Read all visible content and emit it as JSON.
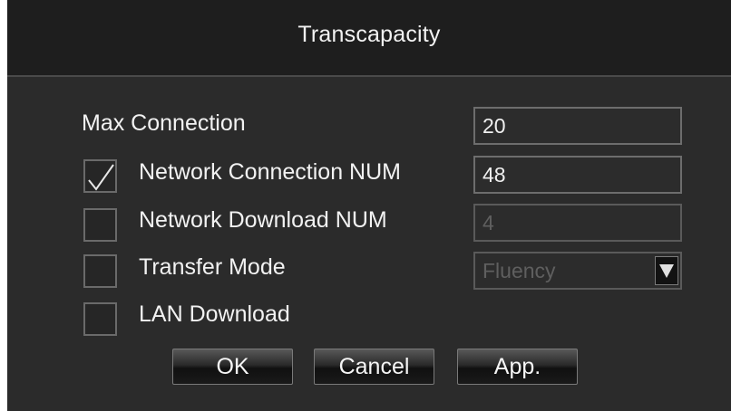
{
  "dialog": {
    "title": "Transcapacity"
  },
  "max_connection": {
    "label": "Max Connection",
    "value": "20"
  },
  "network_connection_num": {
    "label": "Network Connection NUM",
    "value": "48",
    "checked": true
  },
  "network_download_num": {
    "label": "Network Download NUM",
    "value": "4",
    "checked": false,
    "disabled": true
  },
  "transfer_mode": {
    "label": "Transfer Mode",
    "value": "Fluency",
    "checked": false,
    "disabled": true
  },
  "lan_download": {
    "label": "LAN Download",
    "checked": false
  },
  "buttons": {
    "ok": "OK",
    "cancel": "Cancel",
    "apply": "App."
  },
  "icons": {
    "check": "checkmark-icon",
    "dropdown": "dropdown-arrow-icon"
  }
}
